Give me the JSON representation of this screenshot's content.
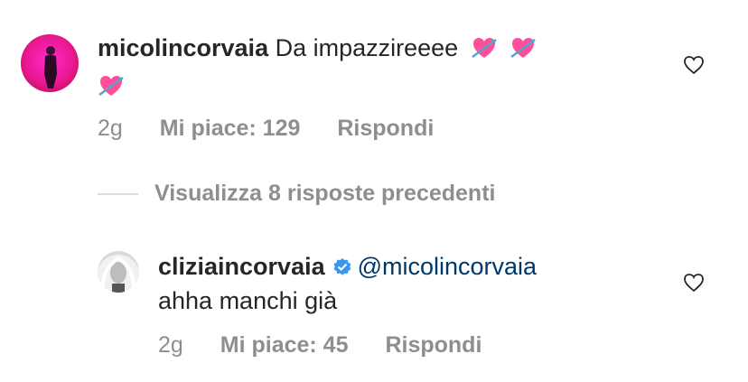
{
  "comment1": {
    "username": "micolincorvaia",
    "text": "Da impazzireeee",
    "emoji_icon": "heart-with-arrow-icon",
    "time": "2g",
    "likes": "Mi piace: 129",
    "reply": "Rispondi"
  },
  "view_replies": "Visualizza 8 risposte precedenti",
  "comment2": {
    "username": "cliziaincorvaia",
    "mention": "@micolincorvaia",
    "text": "ahha manchi già",
    "time": "2g",
    "likes": "Mi piace: 45",
    "reply": "Rispondi"
  },
  "colors": {
    "text": "#262626",
    "meta": "#8e8e8e",
    "mention": "#00376b",
    "verified": "#3897f0"
  }
}
